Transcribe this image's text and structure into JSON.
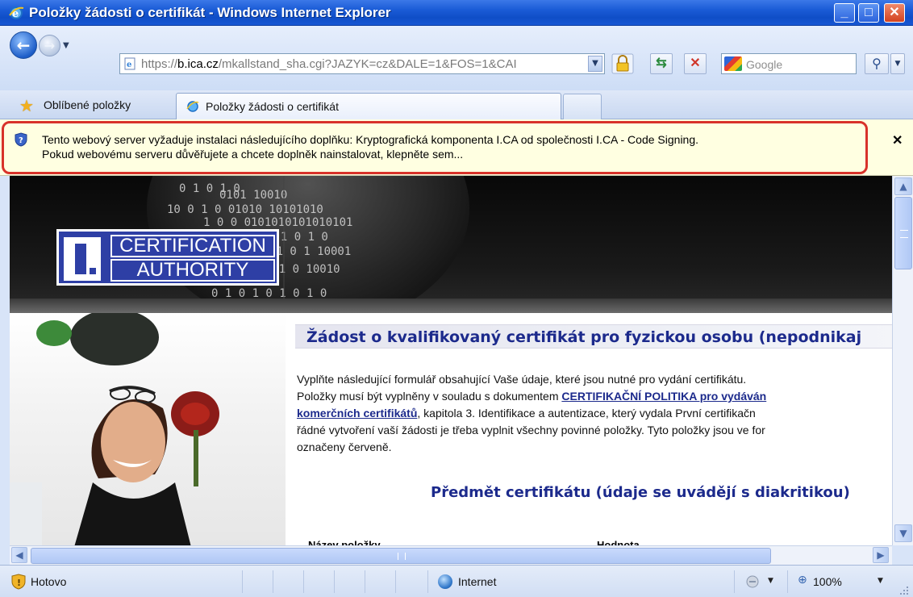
{
  "window": {
    "title": "Položky žádosti o certifikát - Windows Internet Explorer",
    "minimize_glyph": "_",
    "maximize_glyph": "□",
    "close_glyph": "✕"
  },
  "navbar": {
    "address_host_prefix": "https://",
    "address_host": "b.ica.cz",
    "address_path": "/mkallstand_sha.cgi?JAZYK=cz&DALE=1&FOS=1&CAI",
    "refresh_glyph": "⇆",
    "stop_glyph": "✕",
    "search_placeholder": "Google",
    "search_go_glyph": "⚲"
  },
  "favorites": {
    "label": "Oblíbené položky"
  },
  "tab": {
    "label": "Položky žádosti o certifikát"
  },
  "infobar": {
    "line1": "Tento webový server vyžaduje instalaci následujícího doplňku: Kryptografická komponenta I.CA od společnosti I.CA - Code Signing.",
    "line2": "Pokud webovému serveru důvěřujete a chcete doplněk nainstalovat, klepněte sem...",
    "close_glyph": "✕"
  },
  "page": {
    "logo_line1": "CERTIFICATION",
    "logo_line2": "AUTHORITY",
    "heading": "Žádost o kvalifikovaný certifikát pro fyzickou osobu (nepodnikaj",
    "body_l1": "Vyplňte následující formulář obsahující Vaše údaje, které jsou nutné pro vydání certifikátu.",
    "body_l2_pre": "Položky musí být vyplněny v souladu s dokumentem ",
    "body_l2_link": "CERTIFIKAČNÍ POLITIKA pro vydáván",
    "body_l3_link": "komerčních certifikátů",
    "body_l3_post": ", kapitola 3. Identifikace a autentizace, který vydala První certifikačn",
    "body_l4": "řádné vytvoření vaší žádosti je třeba vyplnit všechny povinné položky. Tyto položky jsou ve for",
    "body_l5": "označeny červeně.",
    "section_title": "Předmět certifikátu (údaje se uvádějí s diakritikou)",
    "col_name": "Název položky",
    "col_value": "Hodnota"
  },
  "statusbar": {
    "status": "Hotovo",
    "zone": "Internet",
    "zoom": "100%"
  }
}
